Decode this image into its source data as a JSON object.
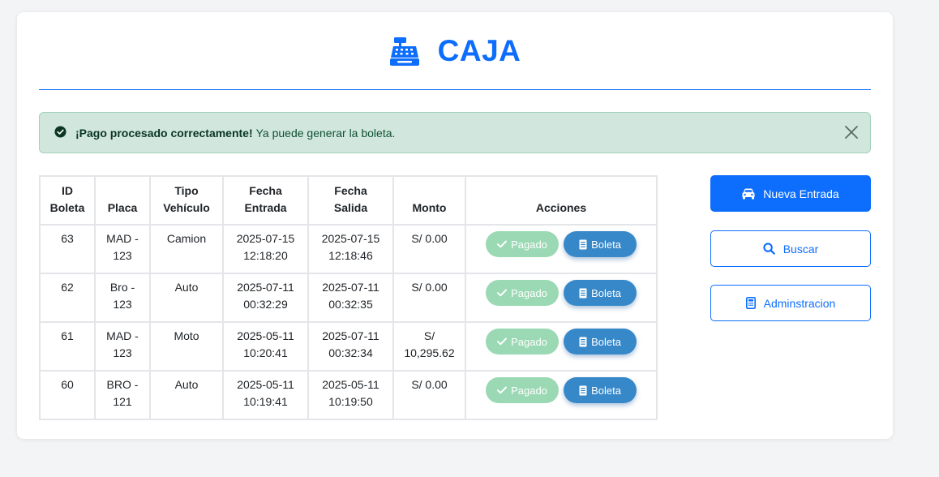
{
  "header": {
    "title": "CAJA",
    "icon": "cash-register-icon",
    "accent_color": "#0d6efd"
  },
  "alert": {
    "strong": "¡Pago procesado correctamente!",
    "message": "Ya puede generar la boleta.",
    "bg_color": "#d1e7dd"
  },
  "table": {
    "headers": {
      "id": [
        "ID",
        "Boleta"
      ],
      "placa": [
        "Placa"
      ],
      "tipo": [
        "Tipo",
        "Vehículo"
      ],
      "entrada": [
        "Fecha",
        "Entrada"
      ],
      "salida": [
        "Fecha",
        "Salida"
      ],
      "monto": [
        "Monto"
      ],
      "acciones": [
        "Acciones"
      ]
    },
    "rows": [
      {
        "id": "63",
        "placa": [
          "MAD -",
          "123"
        ],
        "tipo": "Camion",
        "entrada": [
          "2025-07-15",
          "12:18:20"
        ],
        "salida": [
          "2025-07-15",
          "12:18:46"
        ],
        "monto": [
          "S/ 0.00"
        ]
      },
      {
        "id": "62",
        "placa": [
          "Bro -",
          "123"
        ],
        "tipo": "Auto",
        "entrada": [
          "2025-07-11",
          "00:32:29"
        ],
        "salida": [
          "2025-07-11",
          "00:32:35"
        ],
        "monto": [
          "S/ 0.00"
        ]
      },
      {
        "id": "61",
        "placa": [
          "MAD -",
          "123"
        ],
        "tipo": "Moto",
        "entrada": [
          "2025-05-11",
          "10:20:41"
        ],
        "salida": [
          "2025-07-11",
          "00:32:34"
        ],
        "monto": [
          "S/",
          "10,295.62"
        ]
      },
      {
        "id": "60",
        "placa": [
          "BRO -",
          "121"
        ],
        "tipo": "Auto",
        "entrada": [
          "2025-05-11",
          "10:19:41"
        ],
        "salida": [
          "2025-05-11",
          "10:19:50"
        ],
        "monto": [
          "S/ 0.00"
        ]
      }
    ],
    "paid_label": "Pagado",
    "boleta_label": "Boleta",
    "paid_color": "#9ad9b3",
    "boleta_color": "#3788c9"
  },
  "sidebar": {
    "new_entry": "Nueva Entrada",
    "search": "Buscar",
    "admin": "Adminstracion",
    "new_entry_icon": "car-icon",
    "search_icon": "search-icon",
    "admin_icon": "calculator-icon"
  }
}
